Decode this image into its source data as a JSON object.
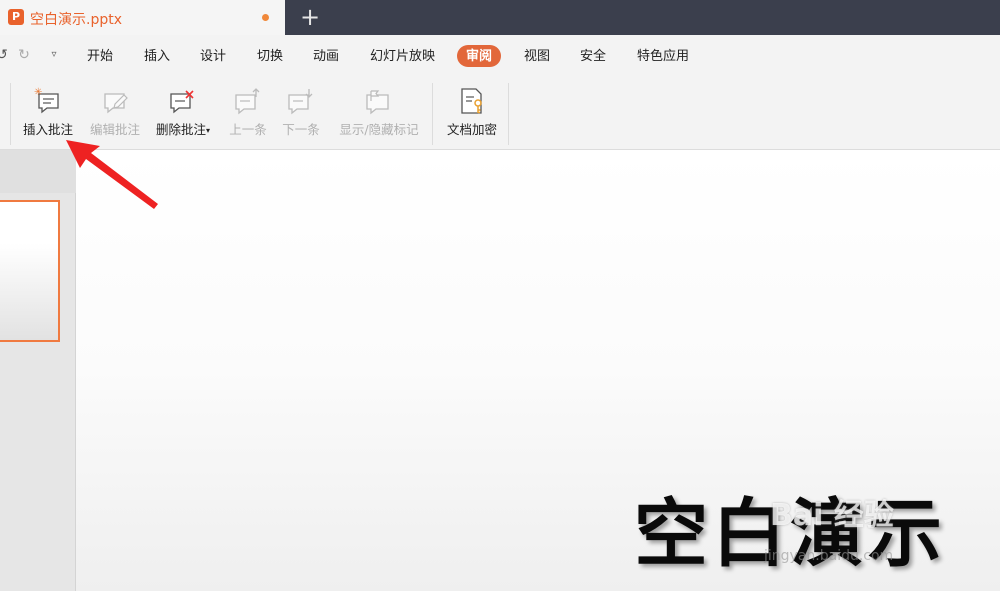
{
  "document": {
    "tab_label": "空白演示.pptx",
    "app_logo": "P"
  },
  "menu": {
    "items": [
      "开始",
      "插入",
      "设计",
      "切换",
      "动画",
      "幻灯片放映",
      "审阅",
      "视图",
      "安全",
      "特色应用"
    ],
    "active": "审阅"
  },
  "ribbon": {
    "insert_comment": "插入批注",
    "edit_comment": "编辑批注",
    "delete_comment": "删除批注",
    "previous": "上一条",
    "next": "下一条",
    "show_hide_marks": "显示/隐藏标记",
    "encrypt_document": "文档加密"
  },
  "slide": {
    "title": "空白演示"
  },
  "watermark": {
    "text": "Bai 经验",
    "url": "jingyan.baidu.com"
  },
  "colors": {
    "accent": "#e2673a",
    "titlebar": "#3b3f4d",
    "arrow": "#ee2222"
  }
}
